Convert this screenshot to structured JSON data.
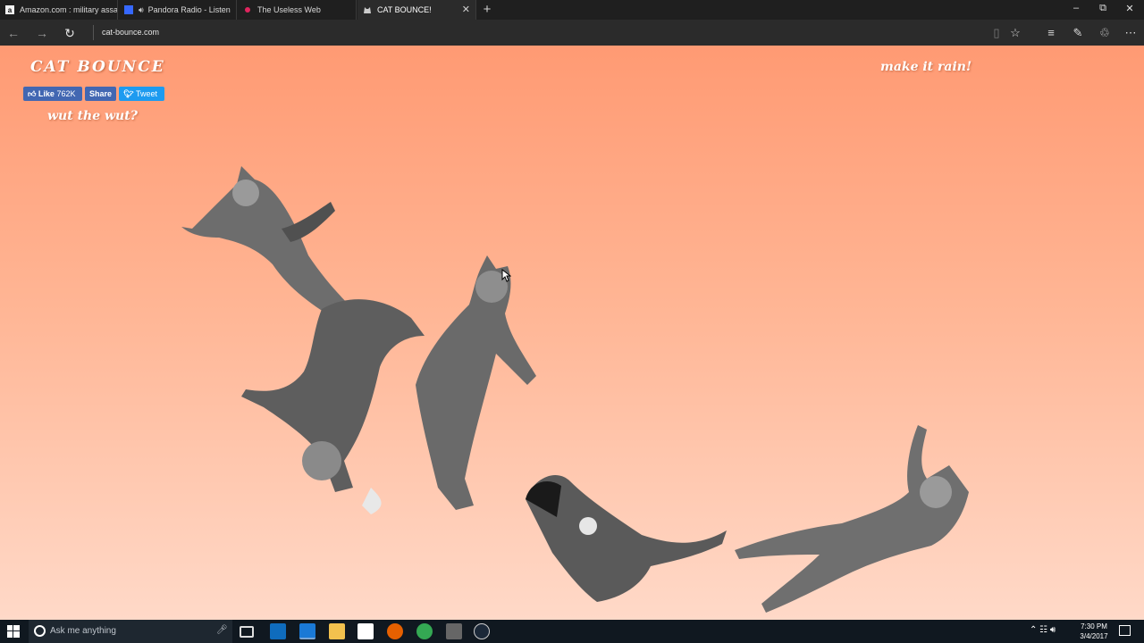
{
  "browser": {
    "tabs": [
      {
        "title": "Amazon.com : military assa",
        "icon": "amazon-icon",
        "active": false
      },
      {
        "title": "Pandora Radio - Listen",
        "icon": "pandora-icon",
        "audio": true,
        "active": false
      },
      {
        "title": "The Useless Web",
        "icon": "useless-web-icon",
        "active": false
      },
      {
        "title": "CAT BOUNCE!",
        "icon": "cat-icon",
        "active": true
      }
    ],
    "new_tab": "+",
    "address": "cat-bounce.com",
    "window_controls": {
      "minimize": "–",
      "restore": "⧉",
      "close": "✕"
    }
  },
  "page": {
    "title": "CAT BOUNCE",
    "like_label": "Like",
    "like_count": "762K",
    "share_label": "Share",
    "tweet_label": "Tweet",
    "subtitle": "wut the wut?",
    "make_rain": "make it rain!",
    "background_top": "#ff9a73",
    "background_bottom": "#ffd9c8"
  },
  "taskbar": {
    "search_placeholder": "Ask me anything",
    "time": "7:30 PM",
    "date": "3/4/2017",
    "apps": [
      "task-view-icon",
      "outlook-icon",
      "edge-icon",
      "file-explorer-icon",
      "store-icon",
      "firefox-icon",
      "chrome-icon",
      "media-app-icon",
      "steam-icon"
    ]
  }
}
